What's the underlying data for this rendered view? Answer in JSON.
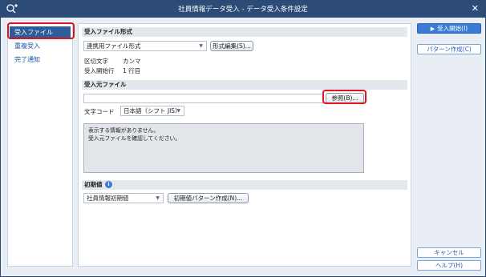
{
  "window": {
    "title": "社員情報データ受入 - データ受入条件設定"
  },
  "sidebar": {
    "items": [
      {
        "label": "受入ファイル"
      },
      {
        "label": "重複受入"
      },
      {
        "label": "完了通知"
      }
    ]
  },
  "file_format": {
    "heading": "受入ファイル形式",
    "selected": "連携用ファイル形式",
    "edit_button": "形式編集(S)...",
    "delimiter_label": "区切文字",
    "delimiter_value": "カンマ",
    "start_row_label": "受入開始行",
    "start_row_value": "1 行目"
  },
  "source_file": {
    "heading": "受入元ファイル",
    "path_value": "",
    "browse_button": "参照(B)...",
    "encoding_label": "文字コード",
    "encoding_selected": "日本語（シフト JIS）",
    "messages": [
      "表示する情報がありません。",
      "受入元ファイルを確認してください。"
    ]
  },
  "initial_values": {
    "heading": "初期値",
    "selected": "社員情報初期値",
    "create_pattern_button": "初期値パターン作成(N)..."
  },
  "actions": {
    "start_import": "受入開始(I)",
    "create_pattern": "パターン作成(C)",
    "cancel": "キャンセル",
    "help": "ヘルプ(H)"
  },
  "colors": {
    "titlebar": "#2c4c77",
    "accent": "#3a7bd5",
    "highlight": "#e0141e",
    "active_nav": "#2c5c9a"
  }
}
